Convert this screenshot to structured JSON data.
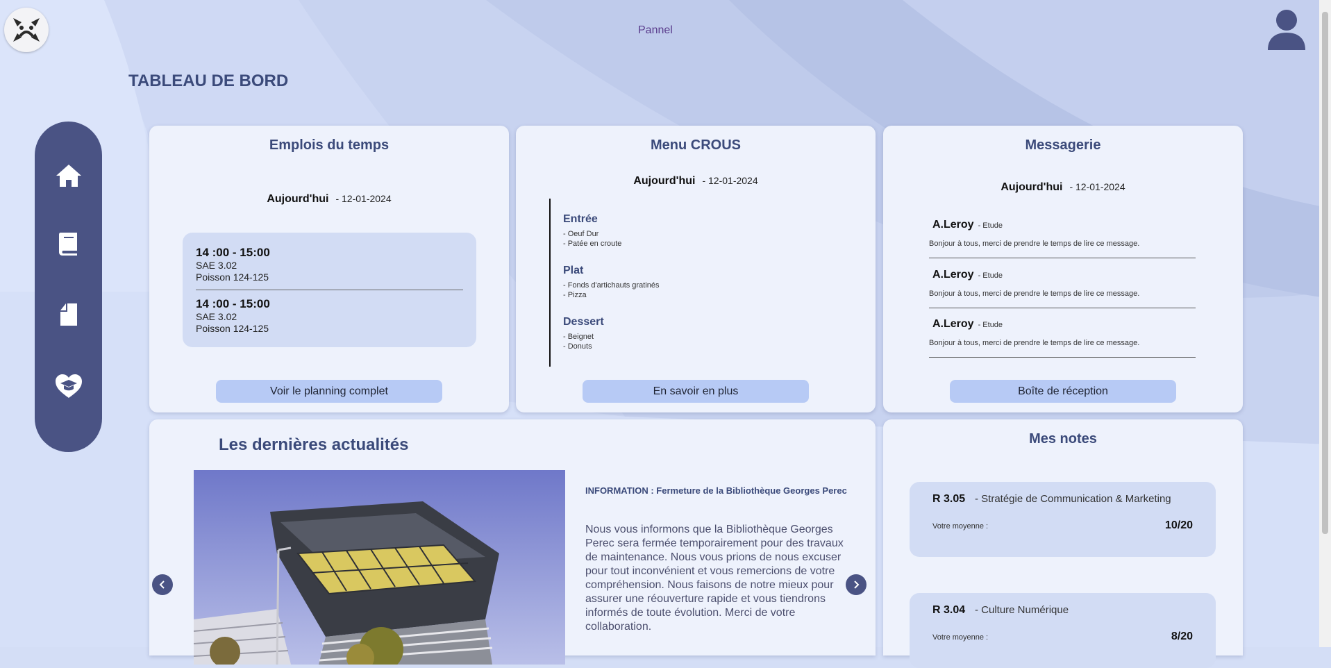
{
  "header": {
    "panel_link": "Pannel",
    "page_title": "TABLEAU DE BORD"
  },
  "sidebar": {
    "items": [
      {
        "icon": "home-icon"
      },
      {
        "icon": "book-icon"
      },
      {
        "icon": "document-icon"
      },
      {
        "icon": "graduation-heart-icon"
      }
    ]
  },
  "schedule": {
    "title": "Emplois du temps",
    "today_label": "Aujourd'hui",
    "date": "- 12-01-2024",
    "slots": [
      {
        "time": "14 :00 - 15:00",
        "course": "SAE 3.02",
        "room": "Poisson 124-125"
      },
      {
        "time": "14 :00 - 15:00",
        "course": "SAE 3.02",
        "room": "Poisson 124-125"
      }
    ],
    "button": "Voir le planning complet"
  },
  "menu": {
    "title": "Menu CROUS",
    "today_label": "Aujourd'hui",
    "date": "- 12-01-2024",
    "sections": [
      {
        "heading": "Entrée",
        "items": [
          "- Oeuf Dur",
          "- Patée en croute"
        ]
      },
      {
        "heading": "Plat",
        "items": [
          "- Fonds d'artichauts gratinés",
          "- Pizza"
        ]
      },
      {
        "heading": "Dessert",
        "items": [
          "- Beignet",
          "- Donuts"
        ]
      }
    ],
    "button": "En savoir en plus"
  },
  "messages": {
    "title": "Messagerie",
    "today_label": "Aujourd'hui",
    "date": "- 12-01-2024",
    "items": [
      {
        "author": "A.Leroy",
        "tag": "- Etude",
        "text": "Bonjour à tous, merci de prendre le temps de lire ce message."
      },
      {
        "author": "A.Leroy",
        "tag": "- Etude",
        "text": "Bonjour à tous, merci de prendre le temps de lire ce message."
      },
      {
        "author": "A.Leroy",
        "tag": "- Etude",
        "text": "Bonjour à tous, merci de prendre le temps de lire ce message."
      }
    ],
    "button": "Boîte de réception"
  },
  "news": {
    "title": "Les dernières actualités",
    "headline": "INFORMATION : Fermeture de la Bibliothèque Georges Perec",
    "body": "Nous vous informons que la Bibliothèque Georges Perec sera fermée temporairement pour des travaux de maintenance. Nous vous prions de nous excuser pour tout inconvénient et vous remercions de votre compréhension. Nous faisons de notre mieux pour assurer une réouverture rapide et vous tiendrons informés de toute évolution. Merci de votre collaboration."
  },
  "grades": {
    "title": "Mes notes",
    "average_label": "Votre moyenne :",
    "items": [
      {
        "code": "R 3.05",
        "name": "- Stratégie de Communication & Marketing",
        "grade": "10/20"
      },
      {
        "code": "R 3.04",
        "name": "- Culture Numérique",
        "grade": "8/20"
      }
    ]
  },
  "colors": {
    "sidebar": "#4a5384",
    "accent_button": "#b7caf5",
    "title_text": "#3b4a7a",
    "card": "#eef2fc",
    "inner_box": "#d2dcf4"
  }
}
